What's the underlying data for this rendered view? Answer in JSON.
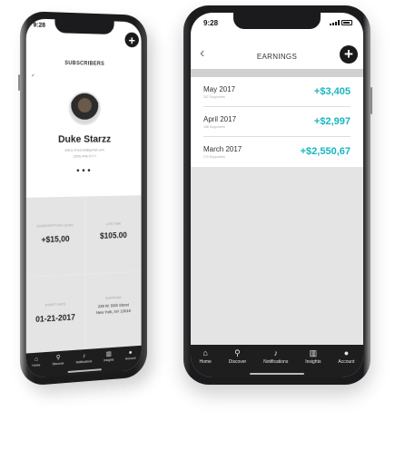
{
  "left_phone": {
    "status_time": "9:28",
    "title": "SUBSCRIBERS",
    "add_label": "+",
    "back_glyph": "‹",
    "profile": {
      "name": "Duke Starzz",
      "email": "starzz.thesoul@gmail.com",
      "phone": "(305) 456-0777",
      "more_glyph": "•••"
    },
    "stats": [
      {
        "label": "Subscription Level",
        "value": "+$15,00"
      },
      {
        "label": "Lifetime",
        "value": "$105.00"
      },
      {
        "label": "Start Date",
        "value": "01-21-2017"
      },
      {
        "label": "Shipping",
        "address_line1": "239 W. 56th Street",
        "address_line2": "New York, NY 10019"
      }
    ],
    "tabs": [
      {
        "label": "Home",
        "icon": "home-icon",
        "glyph": "⌂"
      },
      {
        "label": "Discover",
        "icon": "search-icon",
        "glyph": "⚲"
      },
      {
        "label": "Notifications",
        "icon": "bell-icon",
        "glyph": "♪"
      },
      {
        "label": "Insights",
        "icon": "bar-chart-icon",
        "glyph": "▥"
      },
      {
        "label": "Account",
        "icon": "person-icon",
        "glyph": "●"
      }
    ]
  },
  "right_phone": {
    "status_time": "9:28",
    "title": "EARNINGS",
    "add_label": "+",
    "back_glyph": "‹",
    "earnings": [
      {
        "month": "May 2017",
        "supporters": "287 Supporters",
        "amount": "+$3,405"
      },
      {
        "month": "April 2017",
        "supporters": "188 Supporters",
        "amount": "+$2,997"
      },
      {
        "month": "March 2017",
        "supporters": "170 Supporters",
        "amount": "+$2,550,67"
      }
    ],
    "tabs": [
      {
        "label": "Home",
        "icon": "home-icon",
        "glyph": "⌂"
      },
      {
        "label": "Discover",
        "icon": "search-icon",
        "glyph": "⚲"
      },
      {
        "label": "Notifications",
        "icon": "bell-icon",
        "glyph": "♪"
      },
      {
        "label": "Insights",
        "icon": "bar-chart-icon",
        "glyph": "▥"
      },
      {
        "label": "Account",
        "icon": "person-icon",
        "glyph": "●"
      }
    ]
  },
  "colors": {
    "accent": "#18b6c0",
    "tabbar": "#1e1e1e",
    "frame": "#1b1b1d"
  }
}
